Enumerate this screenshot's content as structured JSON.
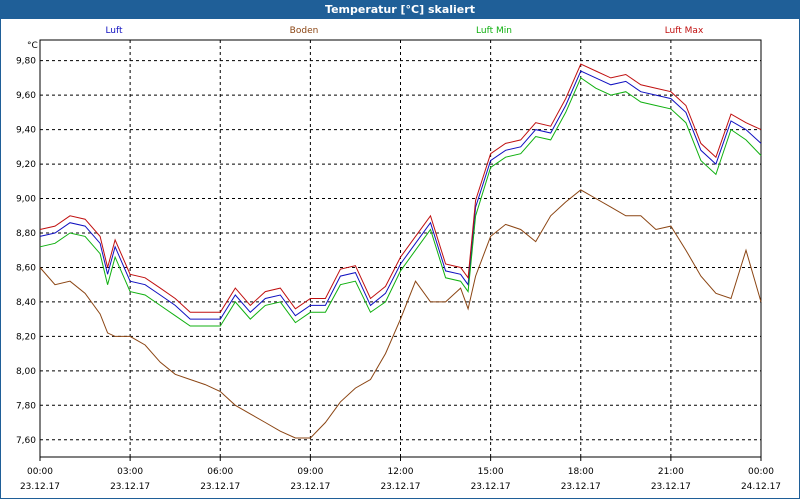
{
  "window": {
    "title": "Temperatur [°C] skaliert"
  },
  "chart_data": {
    "type": "line",
    "title": "Temperatur [°C] skaliert",
    "ylabel": "°C",
    "xlabel": "",
    "ylim": [
      7.5,
      9.92
    ],
    "xlim": [
      0,
      24
    ],
    "grid": true,
    "legend": "top",
    "y_ticks": [
      "9,80",
      "9,60",
      "9,40",
      "9,20",
      "9,00",
      "8,80",
      "8,60",
      "8,40",
      "8,20",
      "8,00",
      "7,80",
      "7,60"
    ],
    "y_tick_values": [
      9.8,
      9.6,
      9.4,
      9.2,
      9.0,
      8.8,
      8.6,
      8.4,
      8.2,
      8.0,
      7.8,
      7.6
    ],
    "x_ticks": [
      {
        "time": "00:00",
        "date": "23.12.17"
      },
      {
        "time": "03:00",
        "date": "23.12.17"
      },
      {
        "time": "06:00",
        "date": "23.12.17"
      },
      {
        "time": "09:00",
        "date": "23.12.17"
      },
      {
        "time": "12:00",
        "date": "23.12.17"
      },
      {
        "time": "15:00",
        "date": "23.12.17"
      },
      {
        "time": "18:00",
        "date": "23.12.17"
      },
      {
        "time": "21:00",
        "date": "23.12.17"
      },
      {
        "time": "00:00",
        "date": "24.12.17"
      }
    ],
    "x_tick_values": [
      0,
      3,
      6,
      9,
      12,
      15,
      18,
      21,
      24
    ],
    "x": [
      0,
      0.5,
      1,
      1.5,
      2,
      2.25,
      2.5,
      3,
      3.5,
      4,
      4.5,
      5,
      5.5,
      6,
      6.5,
      7,
      7.5,
      8,
      8.5,
      9,
      9.5,
      10,
      10.5,
      11,
      11.5,
      12,
      12.5,
      13,
      13.5,
      14,
      14.25,
      14.5,
      15,
      15.5,
      16,
      16.5,
      17,
      17.5,
      18,
      18.5,
      19,
      19.5,
      20,
      20.5,
      21,
      21.5,
      22,
      22.5,
      23,
      23.5,
      24
    ],
    "series": [
      {
        "name": "Luft",
        "color": "#1010c0",
        "values": [
          8.78,
          8.8,
          8.86,
          8.84,
          8.74,
          8.56,
          8.72,
          8.52,
          8.5,
          8.44,
          8.38,
          8.3,
          8.3,
          8.3,
          8.44,
          8.34,
          8.42,
          8.44,
          8.32,
          8.38,
          8.38,
          8.55,
          8.57,
          8.38,
          8.45,
          8.62,
          8.74,
          8.86,
          8.58,
          8.56,
          8.5,
          8.95,
          9.22,
          9.28,
          9.3,
          9.4,
          9.38,
          9.54,
          9.74,
          9.7,
          9.66,
          9.68,
          9.62,
          9.6,
          9.58,
          9.5,
          9.28,
          9.2,
          9.45,
          9.4,
          9.32
        ]
      },
      {
        "name": "Boden",
        "color": "#8b4513",
        "values": [
          8.6,
          8.5,
          8.52,
          8.45,
          8.33,
          8.22,
          8.2,
          8.2,
          8.15,
          8.05,
          7.98,
          7.95,
          7.92,
          7.88,
          7.8,
          7.75,
          7.7,
          7.65,
          7.61,
          7.61,
          7.7,
          7.82,
          7.9,
          7.95,
          8.1,
          8.3,
          8.52,
          8.4,
          8.4,
          8.48,
          8.36,
          8.55,
          8.78,
          8.85,
          8.82,
          8.75,
          8.9,
          8.98,
          9.05,
          9.0,
          8.95,
          8.9,
          8.9,
          8.82,
          8.84,
          8.7,
          8.55,
          8.45,
          8.42,
          8.7,
          8.4
        ]
      },
      {
        "name": "Luft Min",
        "color": "#10b010",
        "values": [
          8.72,
          8.74,
          8.8,
          8.78,
          8.68,
          8.5,
          8.66,
          8.46,
          8.44,
          8.38,
          8.32,
          8.26,
          8.26,
          8.26,
          8.4,
          8.3,
          8.38,
          8.4,
          8.28,
          8.34,
          8.34,
          8.5,
          8.52,
          8.34,
          8.4,
          8.58,
          8.7,
          8.82,
          8.54,
          8.52,
          8.46,
          8.9,
          9.18,
          9.24,
          9.26,
          9.36,
          9.34,
          9.5,
          9.7,
          9.64,
          9.6,
          9.62,
          9.56,
          9.54,
          9.52,
          9.44,
          9.22,
          9.14,
          9.4,
          9.34,
          9.25
        ]
      },
      {
        "name": "Luft Max",
        "color": "#c01010",
        "values": [
          8.82,
          8.84,
          8.9,
          8.88,
          8.78,
          8.6,
          8.76,
          8.56,
          8.54,
          8.48,
          8.42,
          8.34,
          8.34,
          8.34,
          8.48,
          8.38,
          8.46,
          8.48,
          8.36,
          8.42,
          8.42,
          8.59,
          8.61,
          8.42,
          8.49,
          8.66,
          8.78,
          8.9,
          8.62,
          8.6,
          8.54,
          8.99,
          9.26,
          9.32,
          9.34,
          9.44,
          9.42,
          9.58,
          9.78,
          9.74,
          9.7,
          9.72,
          9.66,
          9.64,
          9.62,
          9.54,
          9.32,
          9.24,
          9.49,
          9.44,
          9.4
        ]
      }
    ]
  }
}
